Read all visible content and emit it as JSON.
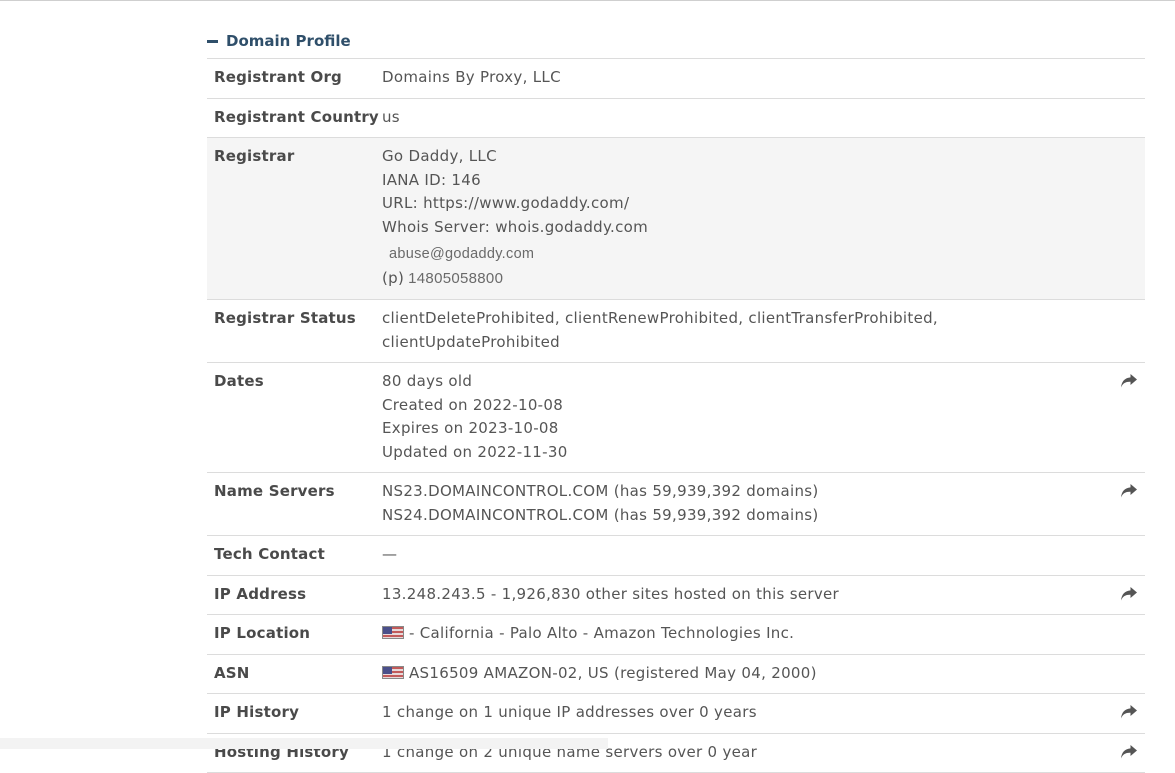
{
  "section": {
    "title": "Domain Profile"
  },
  "rows": {
    "registrant_org": {
      "label": "Registrant Org",
      "value": "Domains By Proxy, LLC"
    },
    "registrant_country": {
      "label": "Registrant Country",
      "value": "us"
    },
    "registrar": {
      "label": "Registrar",
      "name": "Go Daddy, LLC",
      "iana": "IANA ID: 146",
      "url": "URL: https://www.godaddy.com/",
      "whois": "Whois Server: whois.godaddy.com",
      "email": "abuse@godaddy.com",
      "phone_prefix": "(p)",
      "phone": "14805058800"
    },
    "registrar_status": {
      "label": "Registrar Status",
      "line1": "clientDeleteProhibited, clientRenewProhibited, clientTransferProhibited,",
      "line2": "clientUpdateProhibited"
    },
    "dates": {
      "label": "Dates",
      "age": "80 days old",
      "created": "Created on 2022-10-08",
      "expires": "Expires on 2023-10-08",
      "updated": "Updated on 2022-11-30"
    },
    "name_servers": {
      "label": "Name Servers",
      "ns1": "NS23.DOMAINCONTROL.COM (has 59,939,392 domains)",
      "ns2": "NS24.DOMAINCONTROL.COM (has 59,939,392 domains)"
    },
    "tech_contact": {
      "label": "Tech Contact",
      "value": "—"
    },
    "ip_address": {
      "label": "IP Address",
      "value": "13.248.243.5 - 1,926,830 other sites hosted on this server"
    },
    "ip_location": {
      "label": "IP Location",
      "value": "- California - Palo Alto - Amazon Technologies Inc."
    },
    "asn": {
      "label": "ASN",
      "value": "AS16509 AMAZON-02, US (registered May 04, 2000)"
    },
    "ip_history": {
      "label": "IP History",
      "value": "1 change on 1 unique IP addresses over 0 years"
    },
    "hosting_history": {
      "label": "Hosting History",
      "value": "1 change on 2 unique name servers over 0 year"
    }
  },
  "icons": {
    "collapse": "minus-icon",
    "share": "share-arrow-icon",
    "flag": "us-flag-icon"
  }
}
